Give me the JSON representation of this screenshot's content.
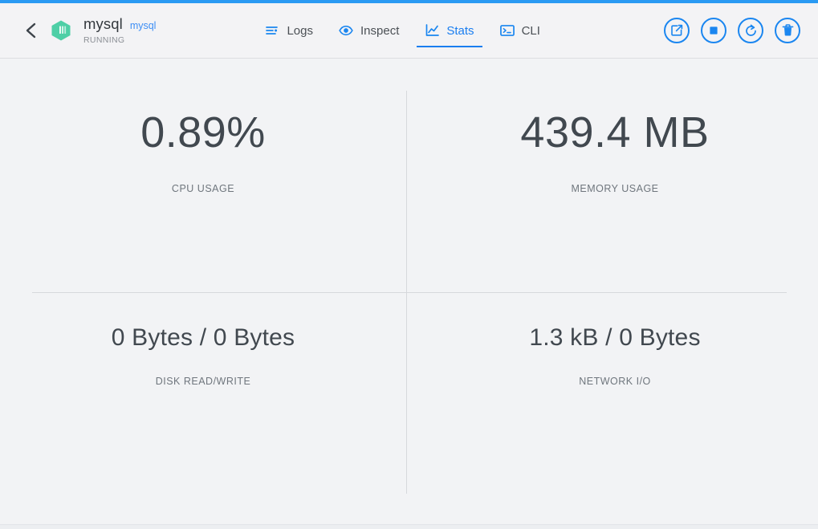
{
  "window": {
    "accent_color": "#2a9af3",
    "background_color": "#f2f3f5"
  },
  "header": {
    "back_icon": "chevron-left-icon",
    "container_icon": "container-cube-icon",
    "container_name": "mysql",
    "image_name": "mysql",
    "status": "RUNNING",
    "tabs": [
      {
        "label": "Logs",
        "icon": "logs-lines-icon",
        "active": false
      },
      {
        "label": "Inspect",
        "icon": "eye-icon",
        "active": false
      },
      {
        "label": "Stats",
        "icon": "chart-line-icon",
        "active": true
      },
      {
        "label": "CLI",
        "icon": "terminal-icon",
        "active": false
      }
    ],
    "actions": [
      {
        "name": "open-external-button",
        "icon": "external-link-icon"
      },
      {
        "name": "stop-button",
        "icon": "stop-square-icon"
      },
      {
        "name": "restart-button",
        "icon": "restart-arrow-icon"
      },
      {
        "name": "remove-button",
        "icon": "trash-icon"
      }
    ]
  },
  "stats": {
    "cpu": {
      "value": "0.89%",
      "label": "CPU USAGE"
    },
    "memory": {
      "value": "439.4 MB",
      "label": "MEMORY USAGE"
    },
    "disk": {
      "value": "0 Bytes / 0 Bytes",
      "label": "DISK READ/WRITE"
    },
    "network": {
      "value": "1.3 kB / 0 Bytes",
      "label": "NETWORK I/O"
    }
  }
}
